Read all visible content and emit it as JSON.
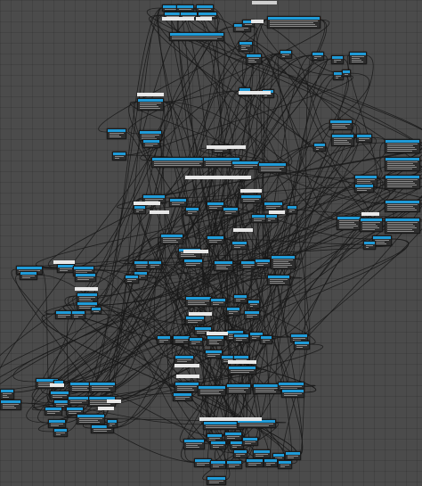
{
  "window": {
    "title": ""
  },
  "colors": {
    "background": "#4b4b4b",
    "node_body": "#2e2e2e",
    "node_header": "#1f9bd8",
    "wire": "#1a1a1a",
    "label_bg": "#e8e8e8"
  },
  "graph": {
    "title": "",
    "view": "node-graph-canvas"
  }
}
